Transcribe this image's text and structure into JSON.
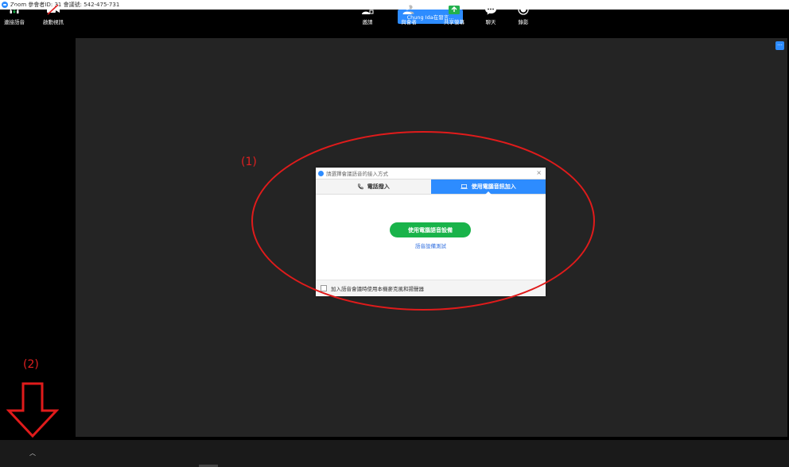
{
  "window": {
    "title": "Zoom 參會者ID: 31   會議號: 542-475-731"
  },
  "speaking_indicator": "Chung Ida在發言...",
  "video": {
    "more_label": "···"
  },
  "annotations": {
    "label_1": "(1)",
    "label_2": "(2)",
    "color": "#e01b1b"
  },
  "dialog": {
    "title": "請選擇會議語音的接入方式",
    "close_label": "×",
    "tabs": [
      {
        "label": "電話撥入",
        "icon": "phone-icon",
        "active": false
      },
      {
        "label": "使用電腦音訊加入",
        "icon": "computer-icon",
        "active": true
      }
    ],
    "join_button": "使用電腦語音設備",
    "test_link": "語音設備測試",
    "footer_checkbox_label": "加入語音會議時使用本機麥克風和揚聲器"
  },
  "toolbar": {
    "left": [
      {
        "label": "連接語音",
        "icon": "headphone-icon"
      },
      {
        "label": "啟動視訊",
        "icon": "video-off-icon"
      }
    ],
    "center": [
      {
        "label": "邀請",
        "icon": "invite-icon"
      },
      {
        "label": "與會者",
        "icon": "participants-icon",
        "count": "2"
      },
      {
        "label": "共享螢幕",
        "icon": "share-screen-icon"
      },
      {
        "label": "聊天",
        "icon": "chat-icon"
      },
      {
        "label": "錄影",
        "icon": "record-icon"
      }
    ]
  },
  "colors": {
    "zoom_blue": "#2d8cff",
    "join_green": "#19b34a",
    "share_green": "#23b14d",
    "background": "#242424"
  }
}
